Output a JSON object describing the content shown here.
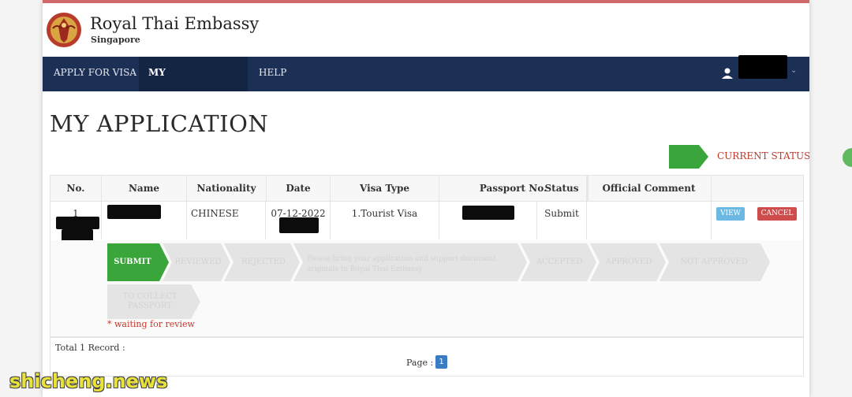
{
  "site": {
    "title": "Royal Thai Embassy",
    "subtitle": "Singapore"
  },
  "nav": {
    "items": [
      {
        "label": "APPLY FOR VISA"
      },
      {
        "label": "MY APPLICATION"
      },
      {
        "label": "HELP"
      }
    ],
    "active": "MY APPLICATION"
  },
  "page": {
    "title": "MY APPLICATION"
  },
  "legend": {
    "label": "CURRENT STATUS",
    "color": "#3aa53a"
  },
  "table": {
    "headers": [
      "No.",
      "Name",
      "Nationality",
      "Date",
      "Visa Type",
      "Passport No.",
      "Status",
      "Official Comment"
    ],
    "row": {
      "no": "1",
      "nationality": "CHINESE",
      "date": "07-12-2022",
      "visa_type": "1.Tourist Visa",
      "status": "Submit",
      "comment": ""
    },
    "actions": {
      "view": "VIEW",
      "cancel": "CANCEL"
    }
  },
  "progress": {
    "steps": [
      "SUBMIT",
      "REVIEWED",
      "REJECTED",
      "Please bring your application and support document originals to Royal Thai Embassy",
      "ACCEPTED",
      "APPROVED",
      "NOT APPROVED",
      "TO COLLECT PASSPORT"
    ],
    "current_index": 0,
    "note": "* waiting for review"
  },
  "footer": {
    "total": "Total 1 Record :",
    "page_label": "Page :",
    "page": "1"
  },
  "watermark": "shicheng.news"
}
